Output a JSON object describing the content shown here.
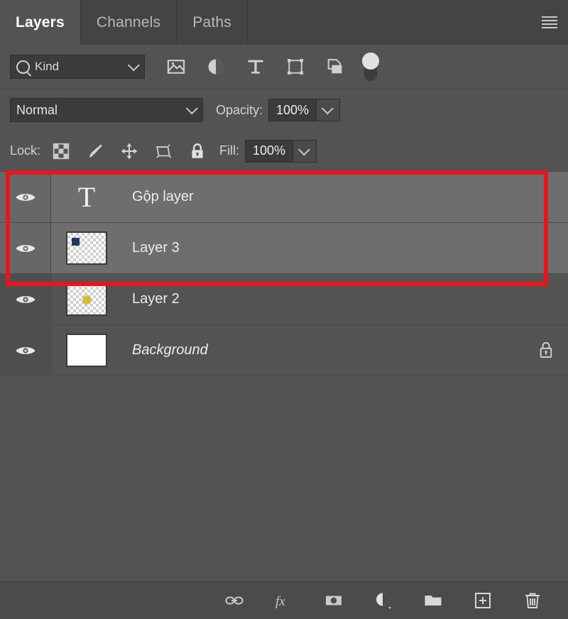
{
  "panel": {
    "tabs": [
      {
        "label": "Layers",
        "active": true
      },
      {
        "label": "Channels",
        "active": false
      },
      {
        "label": "Paths",
        "active": false
      }
    ],
    "menu_icon": "hamburger-menu-icon"
  },
  "filter": {
    "kind_label": "Kind",
    "dropdown_icon": "chevron-down-icon",
    "search_icon": "search-icon",
    "icons": [
      "pixel-layer-filter-icon",
      "adjustment-layer-filter-icon",
      "type-layer-filter-icon",
      "shape-layer-filter-icon",
      "smart-object-filter-icon"
    ],
    "toggle_icon": "filter-toggle-switch"
  },
  "blend": {
    "mode": "Normal",
    "mode_caret": "chevron-down-icon",
    "opacity_label": "Opacity:",
    "opacity_value": "100%",
    "opacity_caret": "chevron-down-icon"
  },
  "lock": {
    "label": "Lock:",
    "icons": [
      "lock-transparent-pixels-icon",
      "lock-image-pixels-icon",
      "lock-position-icon",
      "lock-artboard-nesting-icon",
      "lock-all-icon"
    ],
    "fill_label": "Fill:",
    "fill_value": "100%",
    "fill_caret": "chevron-down-icon"
  },
  "layers": [
    {
      "name": "Gộp layer",
      "thumb_type": "type",
      "thumb_glyph": "T",
      "visible": true,
      "selected": true,
      "italic": false,
      "locked": false
    },
    {
      "name": "Layer 3",
      "thumb_type": "checker-blue",
      "visible": true,
      "selected": true,
      "italic": false,
      "locked": false
    },
    {
      "name": "Layer 2",
      "thumb_type": "checker-yellow",
      "visible": true,
      "selected": false,
      "italic": false,
      "locked": false
    },
    {
      "name": "Background",
      "thumb_type": "white",
      "visible": true,
      "selected": false,
      "italic": true,
      "locked": true,
      "lock_icon": "lock-icon"
    }
  ],
  "annotation": {
    "color": "#e8151b",
    "shape": "rectangle-highlight"
  },
  "bottom_toolbar": {
    "buttons": [
      "link-layers-icon",
      "layer-style-fx-icon",
      "add-layer-mask-icon",
      "new-adjustment-layer-icon",
      "new-group-icon",
      "new-layer-icon",
      "delete-layer-icon"
    ]
  },
  "colors": {
    "panel_bg": "#535353",
    "tabbar_bg": "#444444",
    "selected_row": "#6e6e6e",
    "annotation_red": "#e8151b",
    "thumb_blue": "#203a5c",
    "thumb_yellow": "#d8bb2a"
  }
}
